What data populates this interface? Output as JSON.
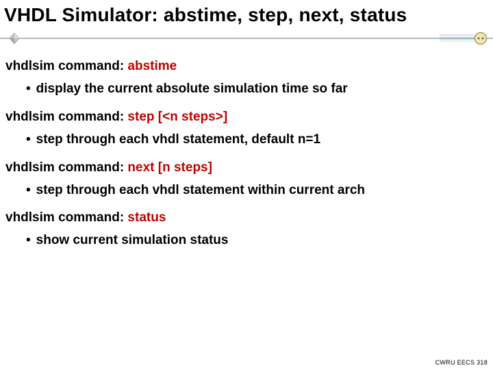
{
  "title": "VHDL Simulator: abstime, step, next, status",
  "sections": [
    {
      "label_prefix": "vhdlsim command: ",
      "keyword": "abstime",
      "args": "",
      "bullet": "display the current absolute simulation time so far"
    },
    {
      "label_prefix": "vhdlsim command: ",
      "keyword": "step",
      "args": " [<n steps>]",
      "bullet": "step through each vhdl statement, default n=1"
    },
    {
      "label_prefix": "vhdlsim command: ",
      "keyword": "next",
      "args": " [n steps]",
      "bullet": "step through each vhdl statement within current arch"
    },
    {
      "label_prefix": "vhdlsim command: ",
      "keyword": "status",
      "args": "",
      "bullet": "show current simulation status"
    }
  ],
  "footer": "CWRU EECS 318",
  "bullet_glyph": "•"
}
